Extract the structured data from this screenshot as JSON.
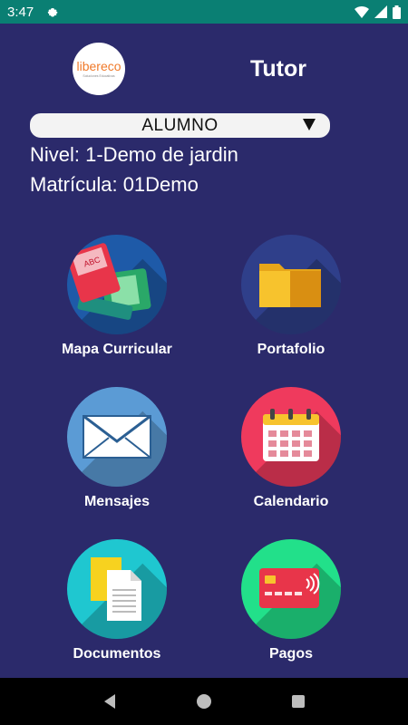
{
  "status": {
    "time": "3:47",
    "icons": [
      "gear-icon",
      "wifi-icon",
      "signal-icon",
      "battery-icon"
    ]
  },
  "logo": {
    "brand": "libereco",
    "tag": "Soluciones Educativas"
  },
  "header": {
    "title": "Tutor"
  },
  "selector": {
    "value": "ALUMNO"
  },
  "student": {
    "level": "Nivel: 1-Demo de jardin",
    "enrollment": "Matrícula: 01Demo"
  },
  "menu": [
    {
      "label": "Mapa Curricular",
      "icon": "books-icon",
      "color": "#1e5aa8"
    },
    {
      "label": "Portafolio",
      "icon": "folder-icon",
      "color": "#2f3f8a"
    },
    {
      "label": "Mensajes",
      "icon": "envelope-icon",
      "color": "#5b9bd5"
    },
    {
      "label": "Calendario",
      "icon": "calendar-icon",
      "color": "#ef3a5d"
    },
    {
      "label": "Documentos",
      "icon": "documents-icon",
      "color": "#1fc7d0"
    },
    {
      "label": "Pagos",
      "icon": "card-icon",
      "color": "#22e08a"
    }
  ],
  "colors": {
    "background": "#2b2a6b",
    "statusbar": "#0a7f73"
  }
}
